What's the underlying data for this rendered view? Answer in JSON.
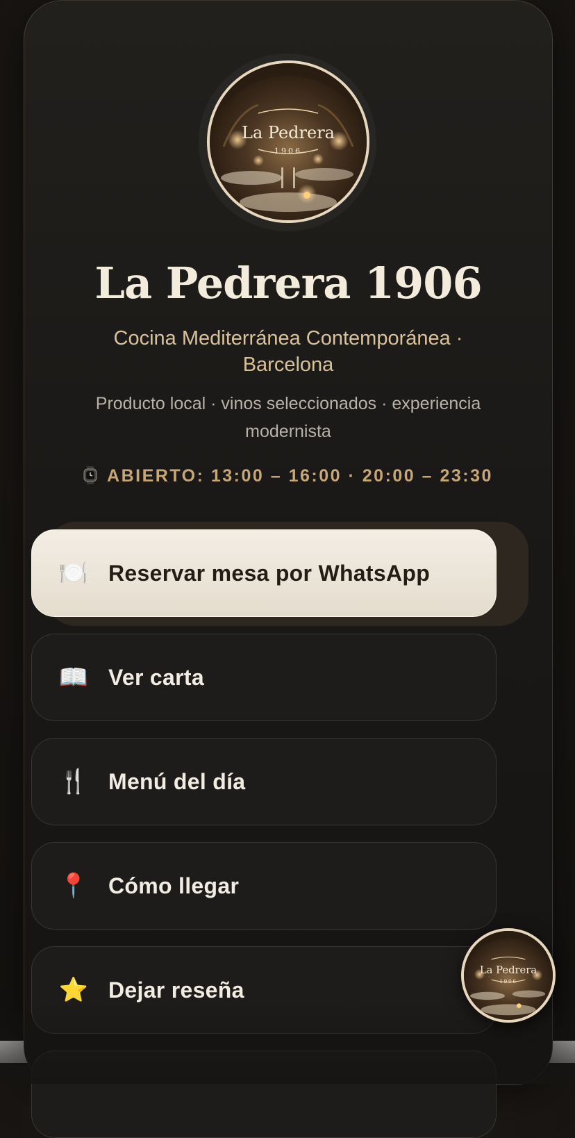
{
  "profile": {
    "logo_text": "La Pedrera",
    "logo_year": "1906",
    "title": "La Pedrera 1906",
    "subtitle": "Cocina Mediterránea Contemporánea · Barcelona",
    "tagline": "Producto local · vinos seleccionados · experiencia modernista",
    "hours_icon": "watch-icon",
    "hours": "ABIERTO: 13:00 – 16:00 · 20:00 – 23:30"
  },
  "buttons": [
    {
      "icon": "🍽️",
      "icon_name": "plate-cutlery-icon",
      "label": "Reservar mesa por WhatsApp",
      "primary": true
    },
    {
      "icon": "📖",
      "icon_name": "open-book-icon",
      "label": "Ver carta"
    },
    {
      "icon": "🍴",
      "icon_name": "fork-knife-icon",
      "label": "Menú del día"
    },
    {
      "icon": "📍",
      "icon_name": "map-pin-icon",
      "label": "Cómo llegar"
    },
    {
      "icon": "⭐",
      "icon_name": "star-icon",
      "label": "Dejar reseña"
    }
  ],
  "colors": {
    "background": "#1b1917",
    "accent_gold": "#c8a776",
    "cream": "#f3eee5",
    "text_light": "#f2ece2"
  }
}
